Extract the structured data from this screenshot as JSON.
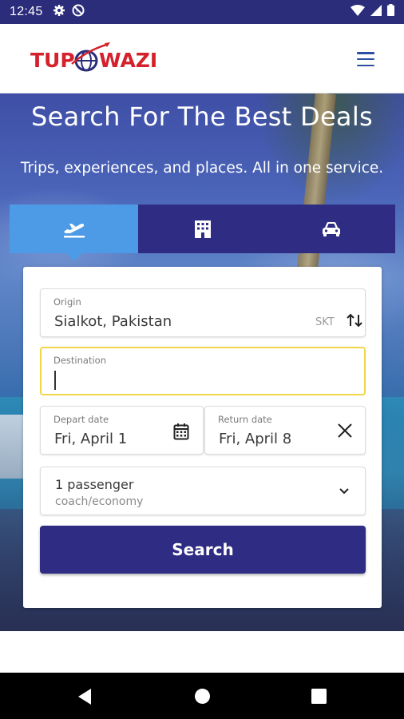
{
  "status_bar": {
    "time": "12:45",
    "left_icons": [
      "gear-icon",
      "do-not-disturb-icon"
    ],
    "right_icons": [
      "wifi-icon",
      "signal-icon",
      "battery-icon"
    ]
  },
  "header": {
    "logo_text": "TUPOWAZI",
    "menu_icon": "hamburger-menu-icon"
  },
  "hero": {
    "title": "Search For The Best Deals",
    "subtitle": "Trips, experiences, and places. All in one service."
  },
  "tabs": [
    {
      "icon": "flight-takeoff-icon",
      "active": true
    },
    {
      "icon": "hotel-icon",
      "active": false
    },
    {
      "icon": "car-icon",
      "active": false
    }
  ],
  "form": {
    "origin": {
      "label": "Origin",
      "value": "Sialkot, Pakistan",
      "code": "SKT"
    },
    "destination": {
      "label": "Destination",
      "value": ""
    },
    "depart": {
      "label": "Depart date",
      "value": "Fri, April 1"
    },
    "return": {
      "label": "Return date",
      "value": "Fri, April 8"
    },
    "passengers": {
      "count": "1 passenger",
      "class": "coach/economy"
    },
    "search_label": "Search"
  },
  "colors": {
    "brand_navy": "#2e2c83",
    "active_tab": "#4d9be6",
    "logo_red": "#d4212b",
    "focus_yellow": "#f1d54a",
    "status_bar": "#2b2c7a"
  },
  "nav_bar": [
    "back-icon",
    "home-icon",
    "recents-icon"
  ]
}
